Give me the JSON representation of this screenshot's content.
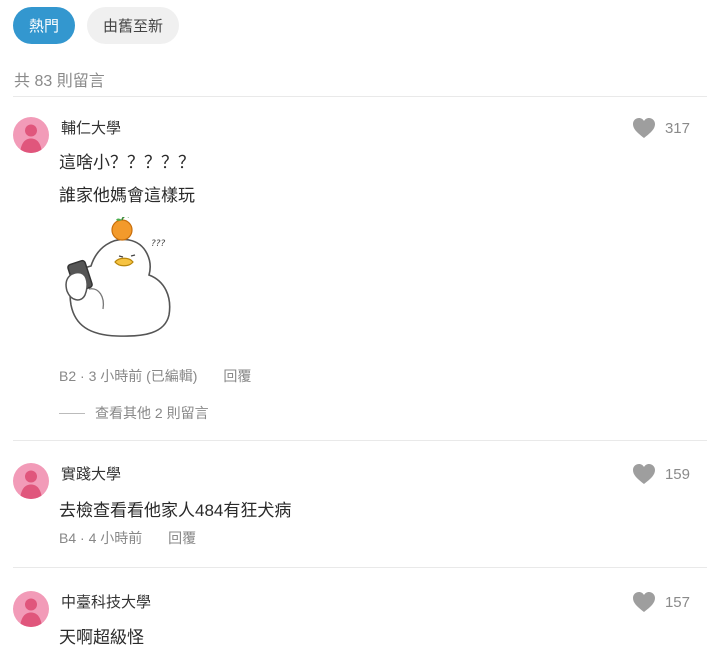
{
  "tabs": {
    "hot": "熱門",
    "oldest": "由舊至新"
  },
  "comment_count": "共 83 則留言",
  "comments": [
    {
      "school": "輔仁大學",
      "lines": [
        "這啥小？？？？？",
        "誰家他媽會這樣玩"
      ],
      "likes": "317",
      "floor": "B2",
      "time": "3 小時前 (已編輯)",
      "reply": "回覆",
      "more": "查看其他 2 則留言"
    },
    {
      "school": "實踐大學",
      "lines": [
        "去檢查看看他家人484有狂犬病"
      ],
      "likes": "159",
      "floor": "B4",
      "time": "4 小時前",
      "reply": "回覆"
    },
    {
      "school": "中臺科技大學",
      "lines": [
        "天啊超級怪"
      ],
      "likes": "157"
    }
  ],
  "sticker_text": "???",
  "colors": {
    "accent": "#3397cf",
    "avatar": "#f29bb8",
    "heart": "#9e9e9e"
  }
}
